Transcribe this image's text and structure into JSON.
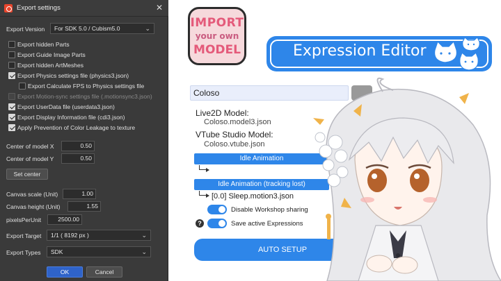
{
  "dialog": {
    "title": "Export settings",
    "close_glyph": "✕",
    "export_version": {
      "label": "Export Version",
      "value": "For SDK 5.0 / Cubism5.0"
    },
    "checkboxes": [
      {
        "label": "Export hidden Parts",
        "checked": false,
        "disabled": false,
        "indent": false
      },
      {
        "label": "Export Guide Image Parts",
        "checked": false,
        "disabled": false,
        "indent": false
      },
      {
        "label": "Export hidden ArtMeshes",
        "checked": false,
        "disabled": false,
        "indent": false
      },
      {
        "label": "Export Physics settings file (physics3.json)",
        "checked": true,
        "disabled": false,
        "indent": false
      },
      {
        "label": "Export Calculate FPS to Physics settings file",
        "checked": false,
        "disabled": false,
        "indent": true
      },
      {
        "label": "Export Motion-sync settings file (.motionsync3.json)",
        "checked": false,
        "disabled": true,
        "indent": false
      },
      {
        "label": "Export UserData file (userdata3.json)",
        "checked": true,
        "disabled": false,
        "indent": false
      },
      {
        "label": "Export Display Information file (cdi3.json)",
        "checked": true,
        "disabled": false,
        "indent": false
      },
      {
        "label": "Apply Prevention of Color Leakage to texture",
        "checked": true,
        "disabled": false,
        "indent": false
      }
    ],
    "center_x": {
      "label": "Center of model X",
      "value": "0.50"
    },
    "center_y": {
      "label": "Center of model Y",
      "value": "0.50"
    },
    "set_center_label": "Set center",
    "canvas_scale": {
      "label": "Canvas scale (Unit)",
      "value": "1.00"
    },
    "canvas_height": {
      "label": "Canvas height (Unit)",
      "value": "1.55"
    },
    "pixels_per_unit": {
      "label": "pixelsPerUnit",
      "value": "2500.00"
    },
    "export_target": {
      "label": "Export Target",
      "value": "1/1 ( 8192 px )"
    },
    "export_types": {
      "label": "Export Types",
      "value": "SDK"
    },
    "ok_label": "OK",
    "cancel_label": "Cancel",
    "chevron": "⌄"
  },
  "badge": {
    "line1": "IMPORT",
    "line2": "your own",
    "line3": "MODEL"
  },
  "editor": {
    "banner_title": "Expression Editor",
    "model_name": "Coloso",
    "live2d_heading": "Live2D Model:",
    "live2d_file": "Coloso.model3.json",
    "vts_heading": "VTube Studio Model:",
    "vts_file": "Coloso.vtube.json",
    "idle_label": "Idle Animation",
    "idle_lost_label": "Idle Animation (tracking lost)",
    "idle_lost_file": "[0.0] Sleep.motion3.json",
    "disable_workshop_label": "Disable Workshop sharing",
    "save_expressions_label": "Save active Expressions",
    "help_glyph": "?",
    "auto_setup_label": "AUTO SETUP"
  },
  "colors": {
    "accent": "#2e86e9",
    "dialog_bg": "#3a3a3a",
    "badge_pink": "#e45a7a"
  }
}
